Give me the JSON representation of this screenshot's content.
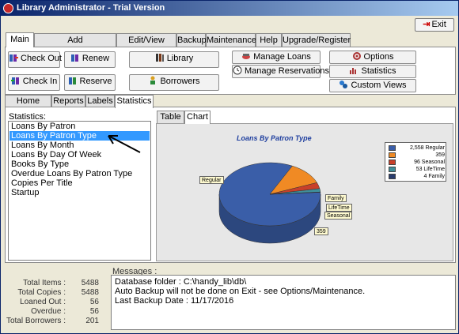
{
  "window": {
    "title": "Library Administrator - Trial Version"
  },
  "exit_label": "Exit",
  "main_tabs": [
    "Main",
    "Add Items/Borrowers",
    "Edit/View Table",
    "Backup",
    "Maintenance",
    "Help",
    "Upgrade/Register"
  ],
  "ribbon": {
    "check_out": "Check Out",
    "renew": "Renew",
    "library": "Library",
    "manage_loans": "Manage Loans",
    "options": "Options",
    "check_in": "Check In",
    "reserve": "Reserve",
    "borrowers": "Borrowers",
    "manage_reservations": "Manage Reservations",
    "statistics": "Statistics",
    "custom_views": "Custom Views"
  },
  "sub_tabs": [
    "Home Page",
    "Reports",
    "Labels",
    "Statistics"
  ],
  "statistics": {
    "label": "Statistics:",
    "items": [
      "Loans By Patron",
      "Loans By Patron Type",
      "Loans By Month",
      "Loans By Day Of Week",
      "Books By Type",
      "Overdue Loans By Patron Type",
      "Copies Per Title",
      "Startup"
    ],
    "selected": "Loans By Patron Type"
  },
  "chart_tabs": [
    "Table",
    "Chart"
  ],
  "chart_data": {
    "type": "pie",
    "title": "Loans By Patron Type",
    "categories": [
      "Regular",
      "",
      "Seasonal",
      "LifeTime",
      "Family"
    ],
    "values": [
      2558,
      359,
      96,
      53,
      4
    ],
    "legend": [
      "2,558 Regular",
      "359",
      "96 Seasonal",
      "53 LifeTime",
      "4 Family"
    ],
    "callouts": [
      "Regular",
      "Family",
      "LifeTime",
      "Seasonal",
      "359"
    ],
    "colors": [
      "#3a5ea8",
      "#f08a24",
      "#c8402a",
      "#3f8f9a",
      "#2a3d6e"
    ],
    "legend_placement": "right"
  },
  "messages": {
    "label": "Messages :",
    "lines": [
      "Database folder : C:\\handy_lib\\db\\",
      "Auto Backup will not be done on Exit - see Options/Maintenance.",
      "Last Backup Date : 11/17/2016"
    ]
  },
  "summary": [
    {
      "label": "Total Items :",
      "value": "5488"
    },
    {
      "label": "Total Copies :",
      "value": "5488"
    },
    {
      "label": "Loaned Out :",
      "value": "56"
    },
    {
      "label": "Overdue :",
      "value": "56"
    },
    {
      "label": "Total Borrowers :",
      "value": "201"
    }
  ]
}
